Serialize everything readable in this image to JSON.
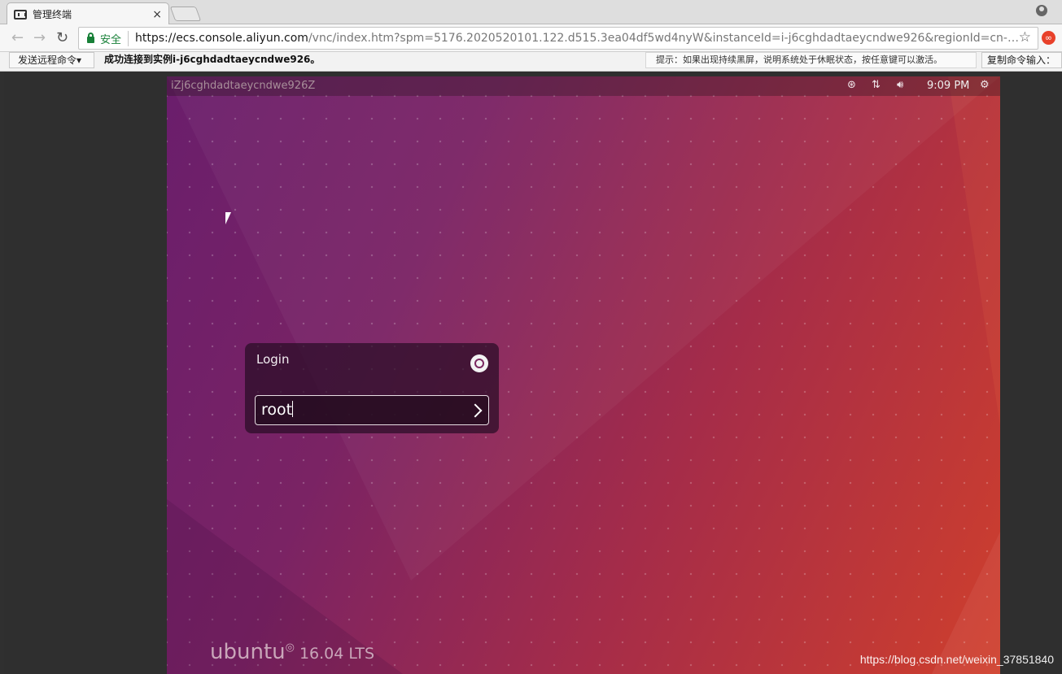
{
  "browser": {
    "tab_title": "管理终端",
    "secure_label": "安全",
    "url_host": "https://ecs.console.aliyun.com",
    "url_rest": "/vnc/index.htm?spm=5176.2020520101.122.d515.3ea04df5wd4nyW&instanceId=i-j6cghdadtaeycndwe926&regionId=cn-hongk..."
  },
  "vnc": {
    "send_command_label": "发送远程命令▾",
    "status_text": "成功连接到实例i-j6cghdadtaeycndwe926。",
    "hint_text": "提示：如果出现持续黑屏，说明系统处于休眠状态，按任意键可以激活。",
    "copy_command_label": "复制命令输入："
  },
  "desktop": {
    "hostname": "iZj6cghdadtaeycndwe926Z",
    "clock": "9:09 PM",
    "login_title": "Login",
    "login_value": "root",
    "brand_name": "ubuntu",
    "brand_version": "16.04 LTS"
  },
  "watermark": "https://blog.csdn.net/weixin_37851840",
  "colors": {
    "secure_green": "#188038",
    "ubuntu_purple": "#6a1e6c",
    "ubuntu_orange": "#cf3f2c"
  }
}
